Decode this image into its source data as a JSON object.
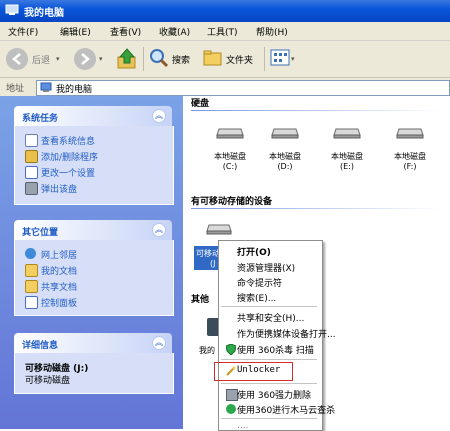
{
  "window": {
    "title": "我的电脑"
  },
  "menubar": {
    "items": [
      "文件(F)",
      "编辑(E)",
      "查看(V)",
      "收藏(A)",
      "工具(T)",
      "帮助(H)"
    ]
  },
  "toolbar": {
    "back_label": "后退",
    "search_label": "搜索",
    "folders_label": "文件夹"
  },
  "address": {
    "label": "地址",
    "value": "我的电脑"
  },
  "left_panels": {
    "system_tasks": {
      "title": "系统任务",
      "items": [
        "查看系统信息",
        "添加/删除程序",
        "更改一个设置",
        "弹出该盘"
      ]
    },
    "other_places": {
      "title": "其它位置",
      "items": [
        "网上邻居",
        "我的文档",
        "共享文档",
        "控制面板"
      ]
    },
    "details": {
      "title": "详细信息",
      "name": "可移动磁盘 (J:)",
      "type": "可移动磁盘"
    }
  },
  "main": {
    "hard_disks_header": "硬盘",
    "drives": [
      {
        "label": "本地磁盘",
        "letter": "(C:)"
      },
      {
        "label": "本地磁盘",
        "letter": "(D:)"
      },
      {
        "label": "本地磁盘",
        "letter": "(E:)"
      },
      {
        "label": "本地磁盘",
        "letter": "(F:)"
      }
    ],
    "removable_header": "有可移动存储的设备",
    "removable_partial": "可移动",
    "removable_partial2": "(J",
    "other_header": "其他",
    "other_partial": "我的"
  },
  "context_menu": {
    "items": [
      "打开(O)",
      "资源管理器(X)",
      "命令提示符",
      "搜索(E)...",
      "共享和安全(H)...",
      "作为便携媒体设备打开...",
      "使用 360杀毒 扫描",
      "Unlocker",
      "使用 360强力删除",
      "使用360进行木马云查杀",
      "...."
    ]
  },
  "colors": {
    "title_bar": "#0a55d9",
    "left_pane": "#6c8ee0",
    "accent_blue": "#215dc6",
    "highlight_red": "#d22c2c"
  }
}
